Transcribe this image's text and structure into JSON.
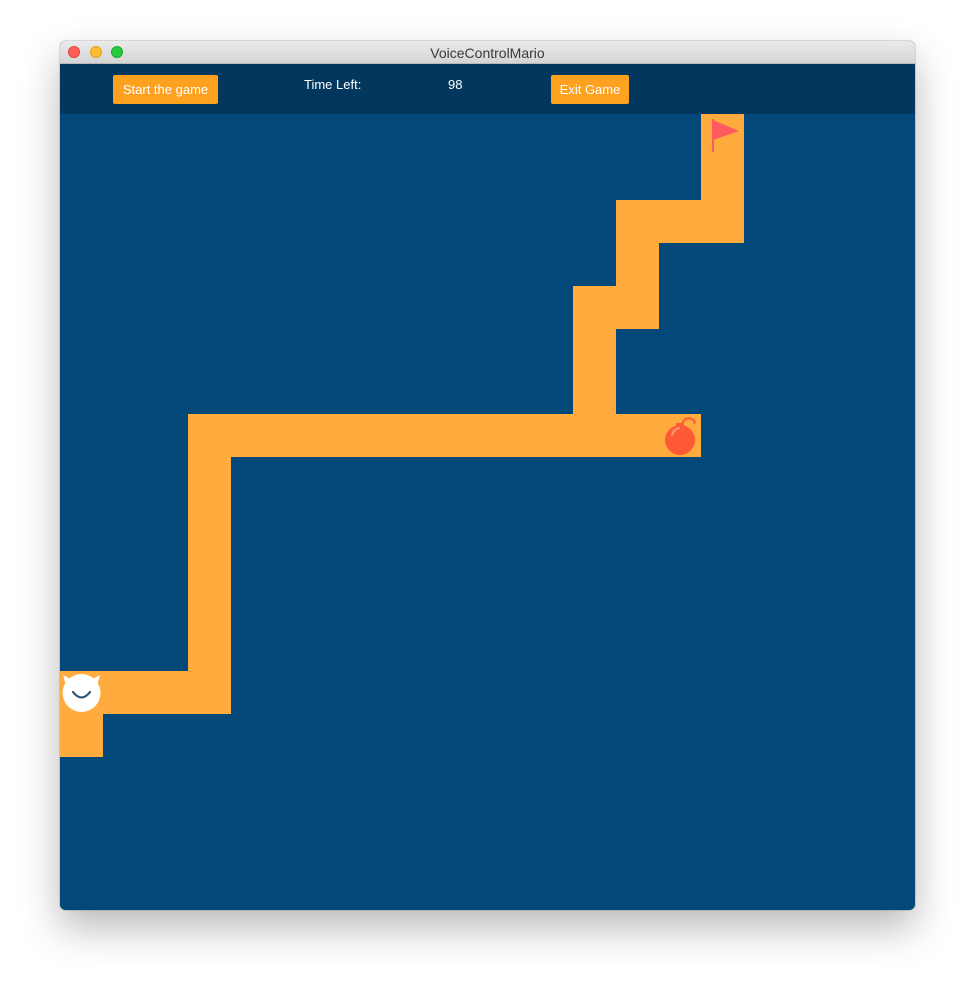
{
  "window": {
    "title": "VoiceControlMario"
  },
  "toolbar": {
    "start_label": "Start the game",
    "time_label": "Time Left:",
    "time_value": "98",
    "exit_label": "Exit Game"
  },
  "colors": {
    "board_background": "#024879",
    "toolbar_background": "#03375e",
    "path": "#ffab3d",
    "button": "#fea11f",
    "flag": "#ff5a5f",
    "bomb": "#ff5a36"
  },
  "board": {
    "player_icon": "white-cat-face-icon",
    "hazard_icon": "bomb-icon",
    "goal_icon": "red-flag-icon"
  }
}
